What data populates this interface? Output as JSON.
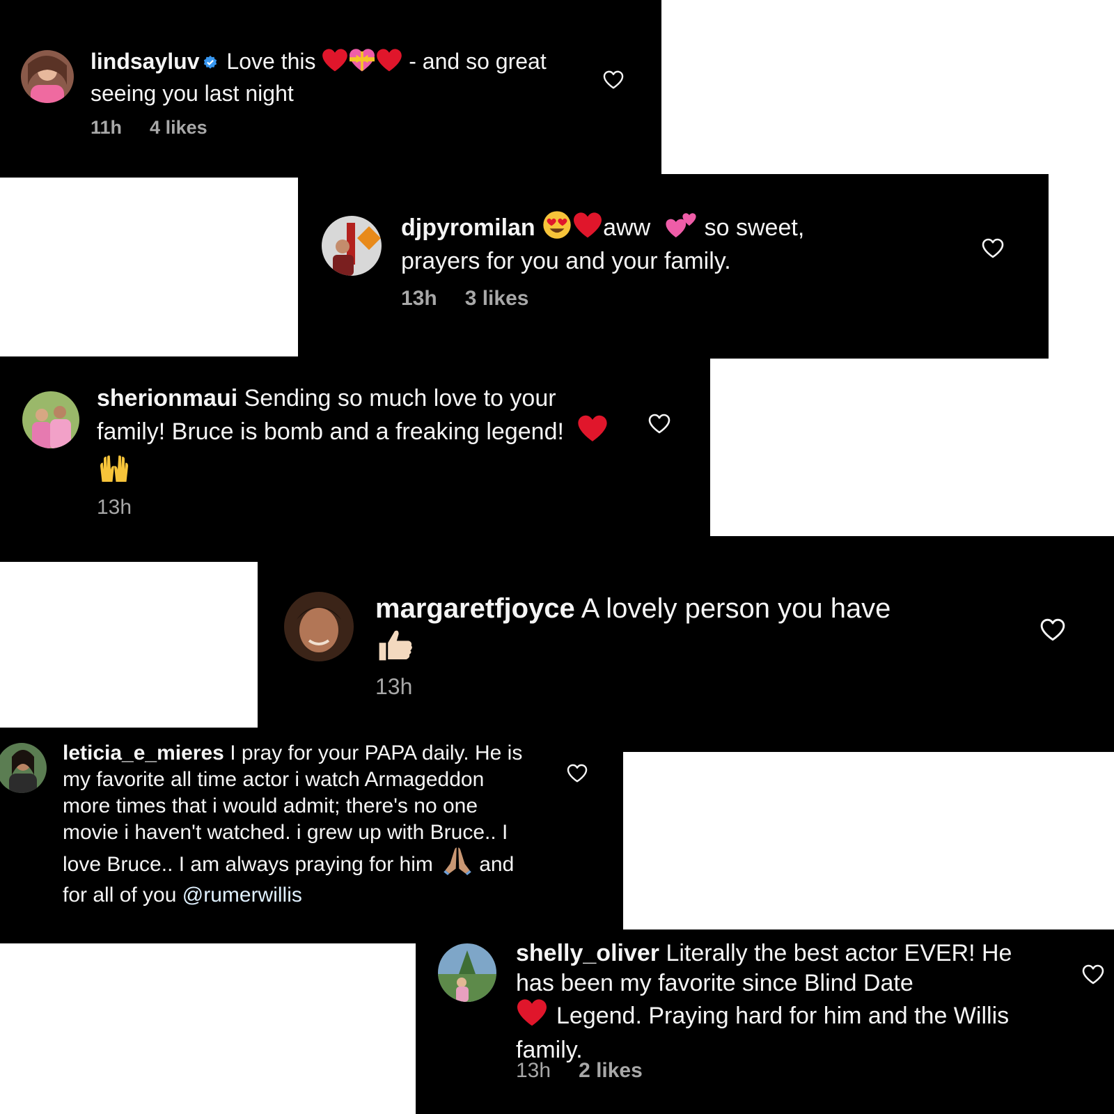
{
  "comments": [
    {
      "username": "lindsayluv",
      "verified_icon": "verified-badge-icon",
      "text_part1": "Love this",
      "text_part2": "- and so great seeing you last night",
      "time": "11h",
      "likes": "4 likes",
      "emojis": [
        "red-heart-emoji",
        "heart-with-ribbon-emoji",
        "red-heart-emoji"
      ]
    },
    {
      "username": "djpyromilan",
      "text_part1": "aww",
      "text_part2": "so sweet, prayers for you and your family.",
      "time": "13h",
      "likes": "3 likes",
      "emojis": [
        "heart-eyes-emoji",
        "red-heart-emoji",
        "two-hearts-emoji"
      ]
    },
    {
      "username": "sherionmaui",
      "text": "Sending so much love to your family! Bruce is bomb and a freaking legend!",
      "time": "13h",
      "emojis": [
        "red-heart-emoji",
        "raising-hands-emoji"
      ]
    },
    {
      "username": "margaretfjoyce",
      "text": "A lovely person you have",
      "time": "13h",
      "emojis": [
        "thumbs-up-emoji"
      ]
    },
    {
      "username": "leticia_e_mieres",
      "text_part1": "I pray for your PAPA daily. He is my favorite all time actor i watch Armageddon more times that i would admit; there's no one movie i haven't watched. i grew up with Bruce.. I love Bruce.. I am always praying for him",
      "text_part2": "and for all of you",
      "mention": "@rumerwillis",
      "emojis": [
        "folded-hands-emoji"
      ]
    },
    {
      "username": "shelly_oliver",
      "text_part1": "Literally the best actor EVER! He has been my favorite since Blind Date",
      "text_part2": "Legend.  Praying hard for him and the Willis family.",
      "time": "13h",
      "likes": "2 likes",
      "emojis": [
        "red-heart-emoji"
      ]
    }
  ],
  "colors": {
    "panel_bg": "#000000",
    "text": "#f5f5f5",
    "meta": "#a8a8a8",
    "verified": "#3897f0",
    "heart_emoji": "#e0162b",
    "page_bg": "#ffffff"
  }
}
